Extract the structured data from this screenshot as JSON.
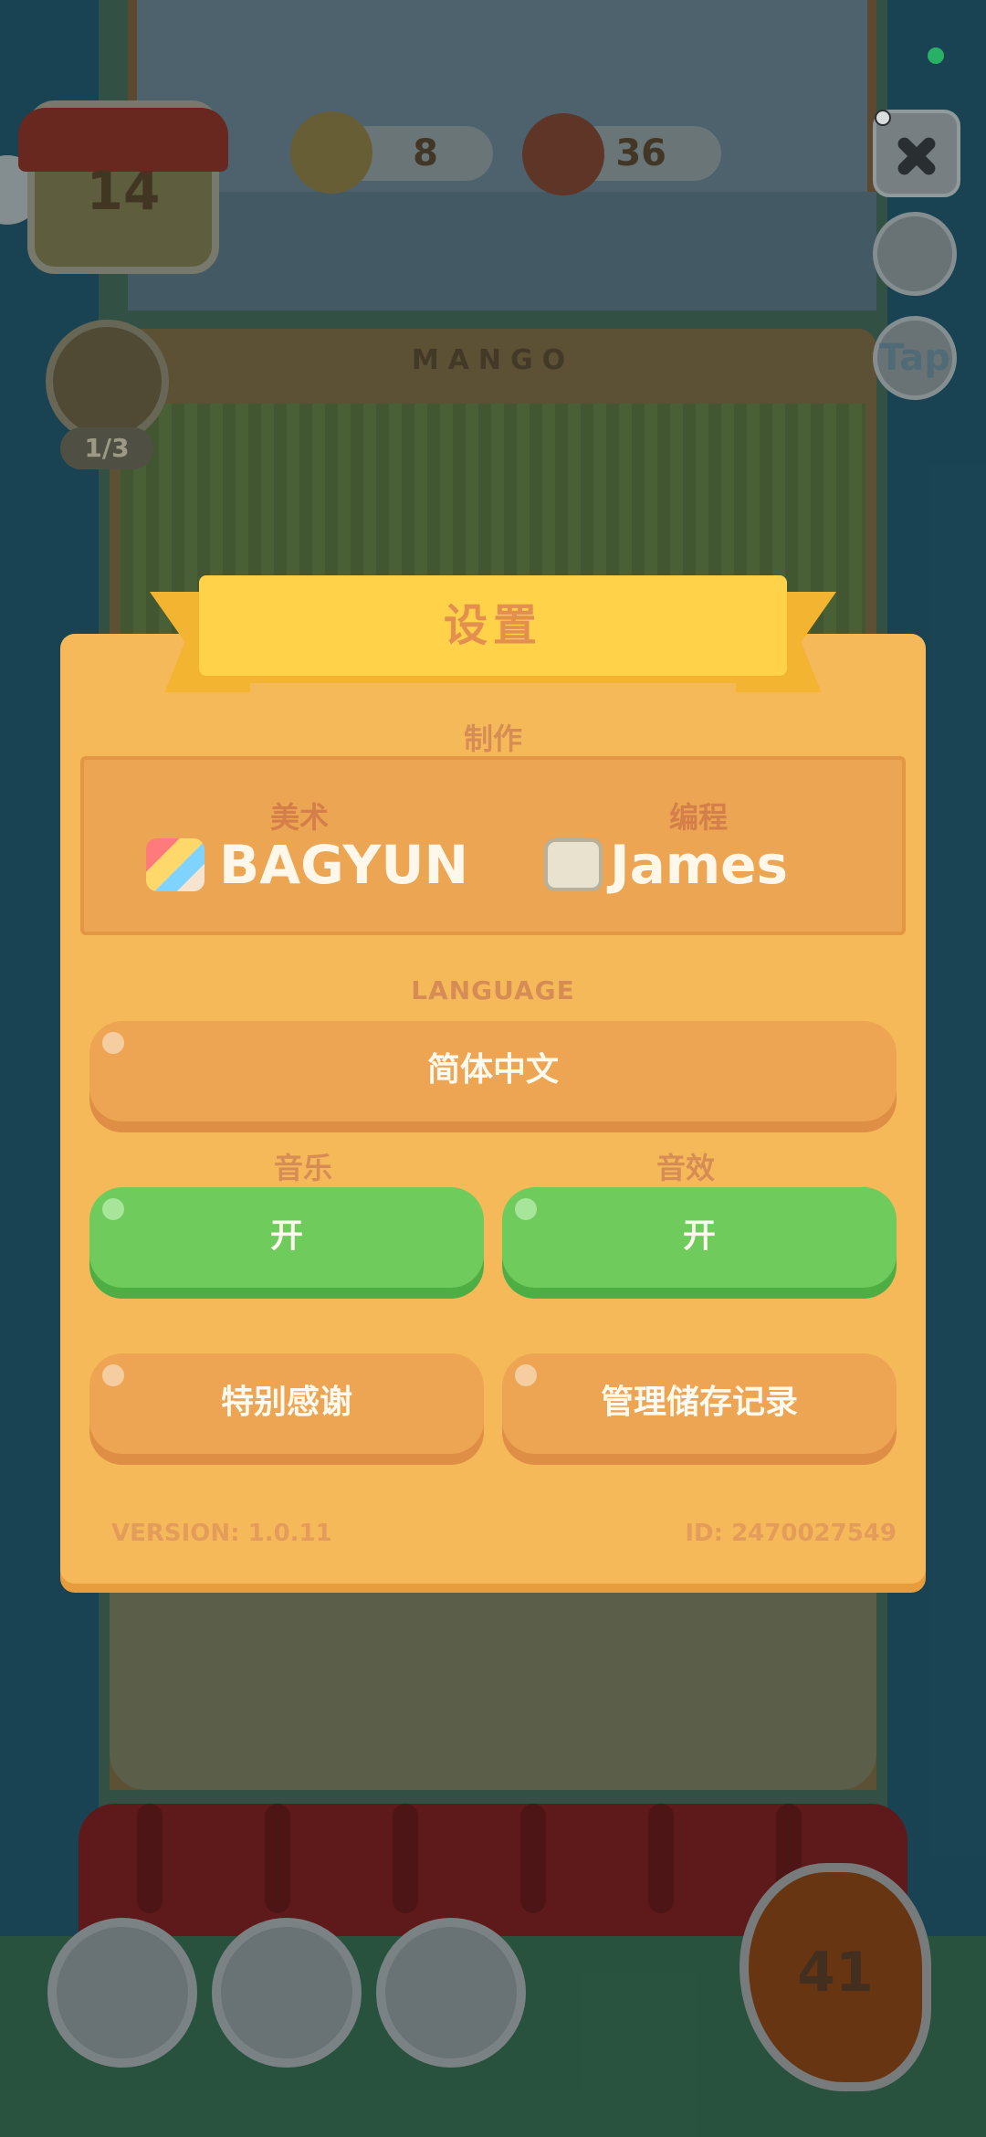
{
  "background": {
    "house_level": "14",
    "pencil_count": "8",
    "can_count": "36",
    "room_sign": "MANGO",
    "task_progress": "1/3",
    "tap_label": "Tap",
    "coin_count": "41"
  },
  "settings": {
    "title": "设置",
    "credits_label": "制作",
    "art_role": "美术",
    "art_name": "BAGYUN",
    "code_role": "编程",
    "code_name": "James",
    "language_label": "LANGUAGE",
    "language_value": "简体中文",
    "music_label": "音乐",
    "music_value": "开",
    "sfx_label": "音效",
    "sfx_value": "开",
    "thanks_label": "特别感谢",
    "saves_label": "管理储存记录",
    "version": "VERSION: 1.0.11",
    "id": "ID: 2470027549"
  },
  "colors": {
    "panel": "#f6b95a",
    "ribbon": "#ffd24a",
    "button_orange": "#eda553",
    "button_green": "#6ecb5c"
  }
}
